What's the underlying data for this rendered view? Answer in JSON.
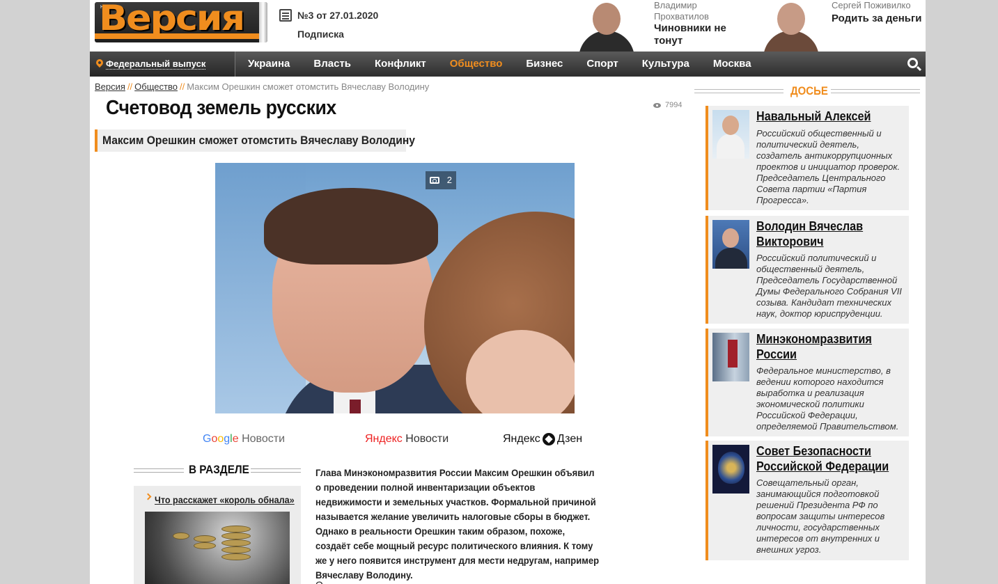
{
  "header": {
    "logo_text": "Версия",
    "logo_small": "НАША",
    "issue": "№3 от 27.01.2020",
    "subscribe": "Подписка",
    "authors": [
      {
        "name": "Владимир Прохватилов",
        "title": "Чиновники не тонут"
      },
      {
        "name": "Сергей Поживилко",
        "title": "Родить за деньги"
      }
    ]
  },
  "nav": {
    "region": "Федеральный выпуск",
    "items": [
      "Украина",
      "Власть",
      "Конфликт",
      "Общество",
      "Бизнес",
      "Спорт",
      "Культура",
      "Москва"
    ],
    "active": "Общество"
  },
  "breadcrumbs": {
    "home": "Версия",
    "section": "Общество",
    "sep": "//",
    "current": "Максим Орешкин сможет отомстить Вячеславу Володину"
  },
  "article": {
    "title": "Счетовод земель русских",
    "views": "7994",
    "subtitle": "Максим Орешкин сможет отомстить Вячеславу Володину",
    "photo_count": "2",
    "lead": "Глава Минэкономразвития России Максим Орешкин объявил о проведении полной инвентаризации объектов недвижимости и земельных участков. Формальной причиной называется желание увеличить налоговые сборы в бюджет. Однако в реальности Орешкин таким образом, похоже, создаёт себе мощный ресурс политического влияния. К тому же у него появится инструмент для мести недругам, например Вячеславу Володину.",
    "more": "О"
  },
  "news_logos": {
    "google_word": [
      "G",
      "o",
      "o",
      "g",
      "l",
      "e"
    ],
    "google_rest": " Новости",
    "yandex_news_y": "Яндекс",
    "yandex_news_rest": " Новости",
    "yandex_zen_left": "Яндекс",
    "yandex_zen_right": "Дзен"
  },
  "in_section": {
    "heading": "В РАЗДЕЛЕ",
    "items": [
      {
        "title": "Что расскажет «король обнала»"
      }
    ]
  },
  "dossier": {
    "heading": "ДОСЬЕ",
    "cards": [
      {
        "name": "Навальный Алексей",
        "desc": "Российский общественный и политический деятель, создатель антикоррупционных проектов и инициатор проверок. Председатель Центрального Совета партии «Партия Прогресса»."
      },
      {
        "name": "Володин Вячеслав Викторович",
        "desc": "Российский политический и общественный деятель, Председатель Государственной Думы Федерального Собрания VII созыва. Кандидат технических наук, доктор юриспруденции."
      },
      {
        "name": "Минэкономразвития России",
        "desc": "Федеральное министерство, в ведении которого находится выработка и реализация экономической политики Российской Федерации, определяемой Правительством."
      },
      {
        "name": "Совет Безопасности Российской Федерации",
        "desc": "Совещательный орган, занимающийся подготовкой решений Президента РФ по вопросам защиты интересов личности, государственных интересов от внутренних и внешних угроз."
      }
    ]
  },
  "colors": {
    "accent": "#f08d1e",
    "nav_bg": "#3a3a3a",
    "page_bg": "#d2d2d2"
  }
}
